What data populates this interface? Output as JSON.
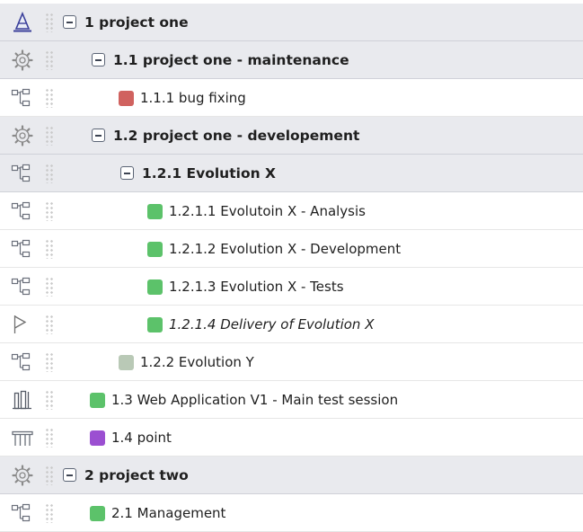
{
  "tree": {
    "rows": [
      {
        "label": "1 project one",
        "icon": "pyramid-icon",
        "bold": true,
        "expanded": true,
        "highlight": true
      },
      {
        "label": "1.1 project one - maintenance",
        "icon": "gear-icon",
        "bold": true,
        "expanded": true,
        "highlight": true
      },
      {
        "label": "1.1.1 bug fixing",
        "icon": "hierarchy-icon",
        "swatch": "#d0625f"
      },
      {
        "label": "1.2 project one - developement",
        "icon": "gear-icon",
        "bold": true,
        "expanded": true,
        "highlight": true
      },
      {
        "label": "1.2.1 Evolution X",
        "icon": "hierarchy-icon",
        "bold": true,
        "expanded": true,
        "highlight": true
      },
      {
        "label": "1.2.1.1 Evolutoin X - Analysis",
        "icon": "hierarchy-icon",
        "swatch": "#5cc26a"
      },
      {
        "label": "1.2.1.2 Evolution X - Development",
        "icon": "hierarchy-icon",
        "swatch": "#5cc26a"
      },
      {
        "label": "1.2.1.3 Evolution X - Tests",
        "icon": "hierarchy-icon",
        "swatch": "#5cc26a"
      },
      {
        "label": "1.2.1.4 Delivery of Evolution X",
        "icon": "flag-icon",
        "swatch": "#5cc26a",
        "italic": true
      },
      {
        "label": "1.2.2 Evolution Y",
        "icon": "hierarchy-icon",
        "swatch": "#b9c9b6"
      },
      {
        "label": "1.3 Web Application V1 - Main test session",
        "icon": "lab-icon",
        "swatch": "#5cc26a"
      },
      {
        "label": "1.4 point",
        "icon": "table-icon",
        "swatch": "#9b4fd1"
      },
      {
        "label": "2 project two",
        "icon": "gear-icon",
        "bold": true,
        "expanded": true,
        "highlight": true
      },
      {
        "label": "2.1 Management",
        "icon": "hierarchy-icon",
        "swatch": "#5cc26a"
      }
    ]
  }
}
